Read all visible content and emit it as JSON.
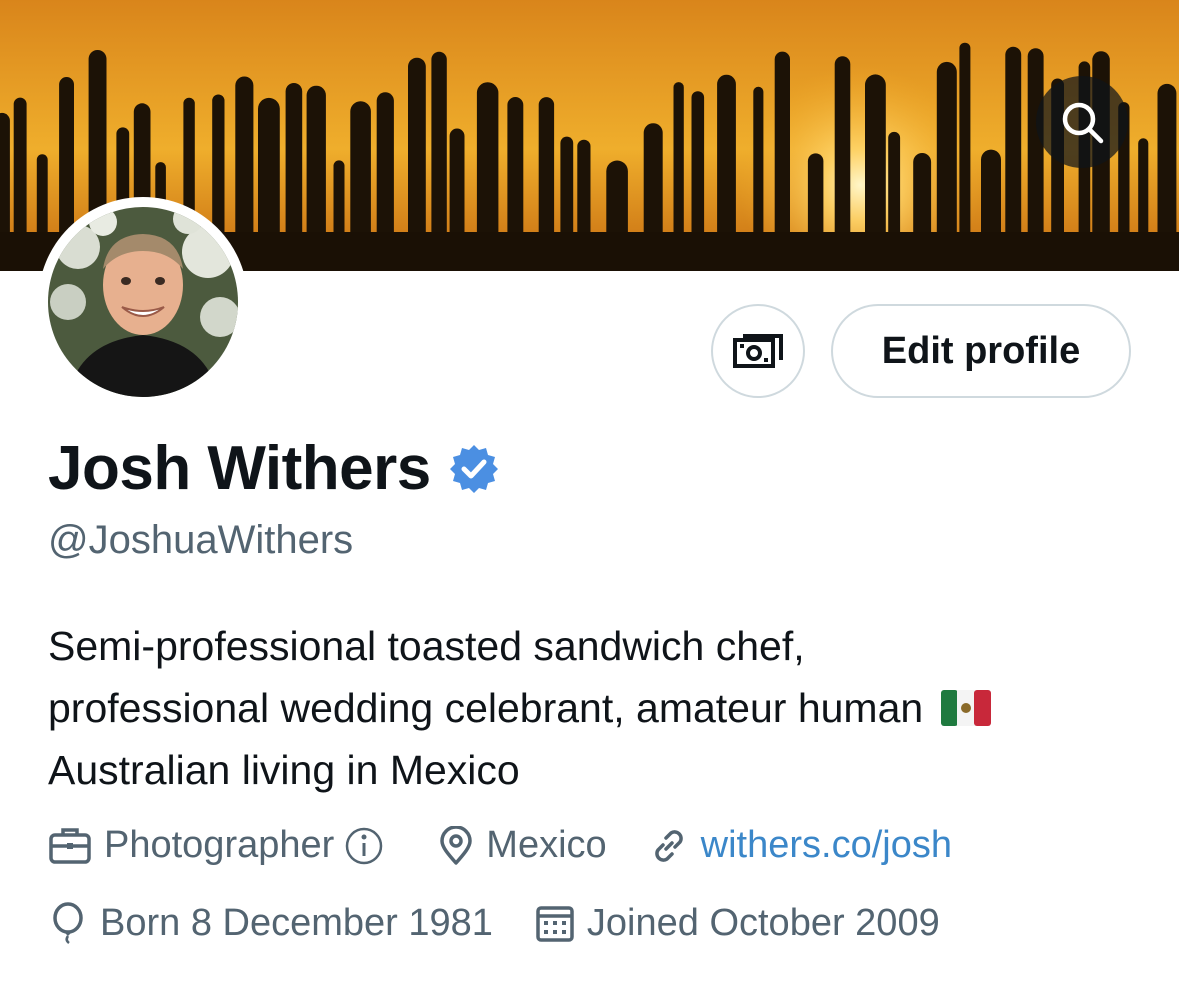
{
  "profile": {
    "display_name": "Josh Withers",
    "handle": "@JoshuaWithers",
    "verified": true,
    "bio_lines": [
      "Semi-professional toasted sandwich chef,",
      "professional wedding celebrant, amateur human",
      "Australian living in Mexico"
    ],
    "bio_flag_icon": "mexico-flag-icon"
  },
  "actions": {
    "search_icon": "search-icon",
    "money_icon": "money-icon",
    "edit_label": "Edit profile"
  },
  "meta": {
    "category": "Photographer",
    "location": "Mexico",
    "website": "withers.co/josh",
    "birthday": "Born 8 December 1981",
    "joined": "Joined October 2009"
  },
  "colors": {
    "accent": "#1d9bf0",
    "link": "#3b87c9",
    "muted_text": "#536471",
    "border": "#cfd9de",
    "banner_sky": "#e49a1e"
  }
}
